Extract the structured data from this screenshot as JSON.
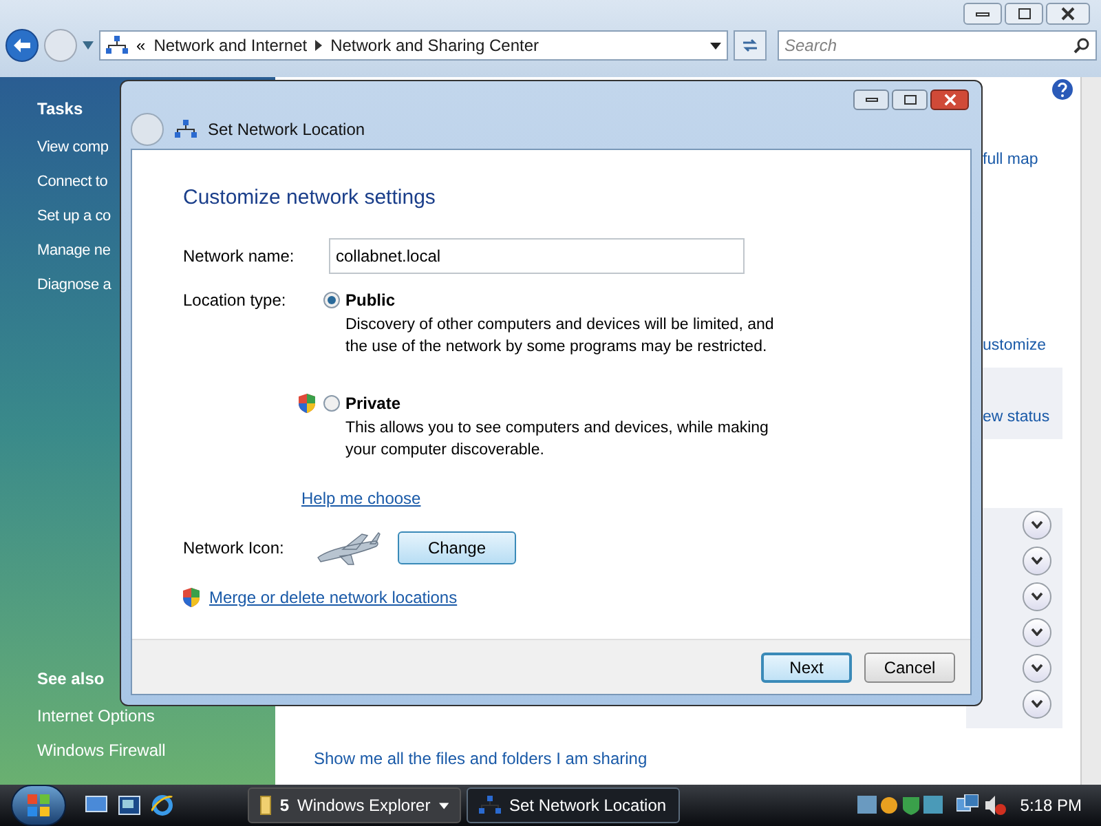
{
  "explorer": {
    "address": {
      "overflow": "«",
      "crumbs": [
        "Network and Internet",
        "Network and Sharing Center"
      ]
    },
    "search": {
      "placeholder": "Search"
    },
    "tasks": {
      "title": "Tasks",
      "items": [
        "View comp",
        "Connect to",
        "Set up a co",
        "Manage ne",
        "Diagnose a"
      ]
    },
    "see_also": {
      "title": "See also",
      "items": [
        "Internet Options",
        "Windows Firewall"
      ]
    },
    "links": [
      "full map",
      "ustomize",
      "ew status"
    ],
    "detail_toggles": [
      {
        "expanded": false
      },
      {
        "expanded": false
      },
      {
        "expanded": false
      },
      {
        "expanded": false
      },
      {
        "expanded": false
      },
      {
        "expanded": false
      }
    ],
    "sharing_link": "Show me all the files and folders I am sharing"
  },
  "dialog": {
    "title": "Set Network Location",
    "heading": "Customize network settings",
    "name_label": "Network name:",
    "name_value": "collabnet.local",
    "location_label": "Location type:",
    "options": [
      {
        "label": "Public",
        "description": "Discovery of other computers and devices will be limited, and the use of the network by some programs may be restricted.",
        "selected": true,
        "shield": false
      },
      {
        "label": "Private",
        "description": "This allows you to see computers and devices, while making your computer discoverable.",
        "selected": false,
        "shield": true
      }
    ],
    "help_link": "Help me choose",
    "icon_label": "Network Icon:",
    "change_button": "Change",
    "merge_link": "Merge or delete network locations",
    "buttons": [
      {
        "label": "Next",
        "default": true
      },
      {
        "label": "Cancel",
        "default": false
      }
    ]
  },
  "taskbar": {
    "items": [
      {
        "count": "5",
        "label": "Windows Explorer",
        "selected": false
      },
      {
        "label": "Set Network Location",
        "selected": true
      }
    ],
    "clock": "5:18 PM"
  }
}
